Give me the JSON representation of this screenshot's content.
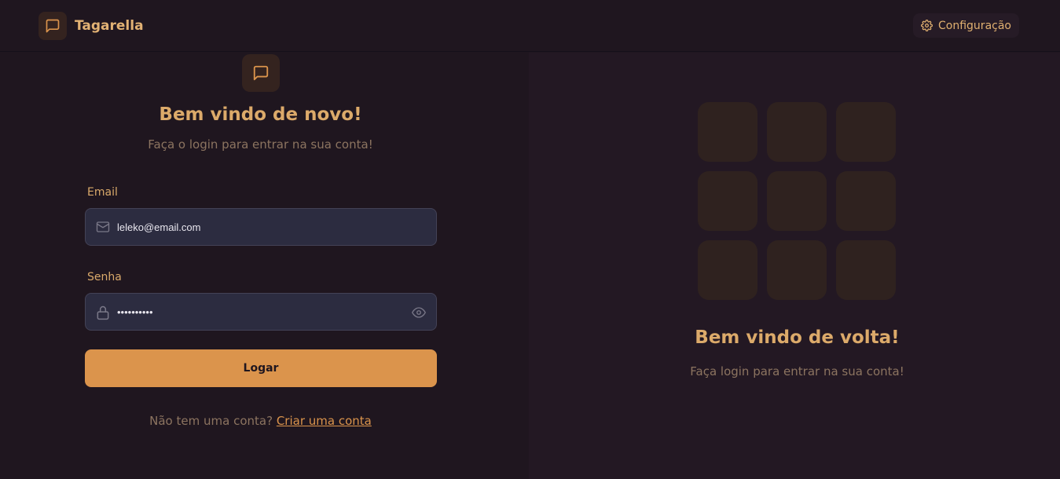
{
  "header": {
    "app_name": "Tagarella",
    "config_label": "Configuração"
  },
  "login": {
    "title": "Bem vindo de novo!",
    "subtitle": "Faça o login para entrar na sua conta!",
    "email_label": "Email",
    "email_value": "leleko@email.com",
    "password_label": "Senha",
    "password_value": "••••••••••",
    "submit_label": "Logar",
    "signup_prompt": "Não tem uma conta?",
    "signup_link": "Criar uma conta"
  },
  "welcome": {
    "title": "Bem vindo de volta!",
    "subtitle": "Faça login para entrar na sua conta!",
    "tile_count": 9
  },
  "colors": {
    "accent": "#db944c",
    "background": "#1f161f",
    "panel": "#231823",
    "input_bg": "#2c2c40"
  },
  "icons": {
    "brand": "chat-bubble-icon",
    "config": "gear-icon",
    "email": "mail-icon",
    "password": "lock-icon",
    "toggle": "eye-icon"
  }
}
